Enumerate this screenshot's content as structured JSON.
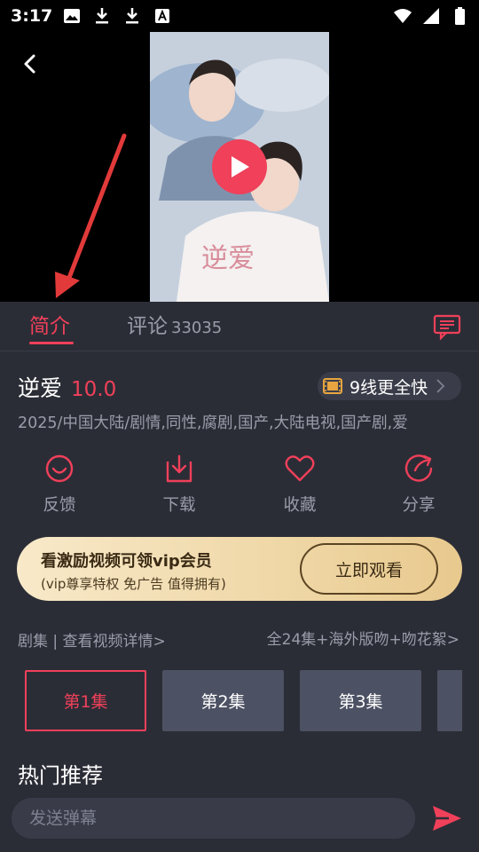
{
  "status_bar": {
    "time": "3:17",
    "left_icons": [
      "image-icon",
      "download-icon",
      "download-icon",
      "a-box-icon"
    ],
    "right_icons": [
      "wifi-icon",
      "signal-icon",
      "battery-icon"
    ]
  },
  "video": {
    "poster_title_text": "逆爱",
    "accent_color": "#f0405a"
  },
  "tabs": {
    "intro_label": "简介",
    "comments_label": "评论",
    "comments_count": "33035"
  },
  "detail": {
    "title": "逆爱",
    "rating": "10.0",
    "line_pill": "9线更全快",
    "meta": "2025/中国大陆/剧情,同性,腐剧,国产,大陆电视,国产剧,爱"
  },
  "actions": [
    {
      "label": "反馈",
      "icon": "feedback-smile-icon"
    },
    {
      "label": "下载",
      "icon": "download-box-icon"
    },
    {
      "label": "收藏",
      "icon": "heart-icon"
    },
    {
      "label": "分享",
      "icon": "share-icon"
    }
  ],
  "vip_banner": {
    "title": "看激励视频可领vip会员",
    "subtitle": "(vip尊享特权 免广告 值得拥有)",
    "button": "立即观看"
  },
  "episodes": {
    "link": "剧集 | 查看视频详情>",
    "total": "全24集+海外版吻+吻花絮>",
    "items": [
      "第1集",
      "第2集",
      "第3集"
    ]
  },
  "section": {
    "hot_title": "热门推荐"
  },
  "danmaku": {
    "placeholder": "发送弹幕"
  }
}
